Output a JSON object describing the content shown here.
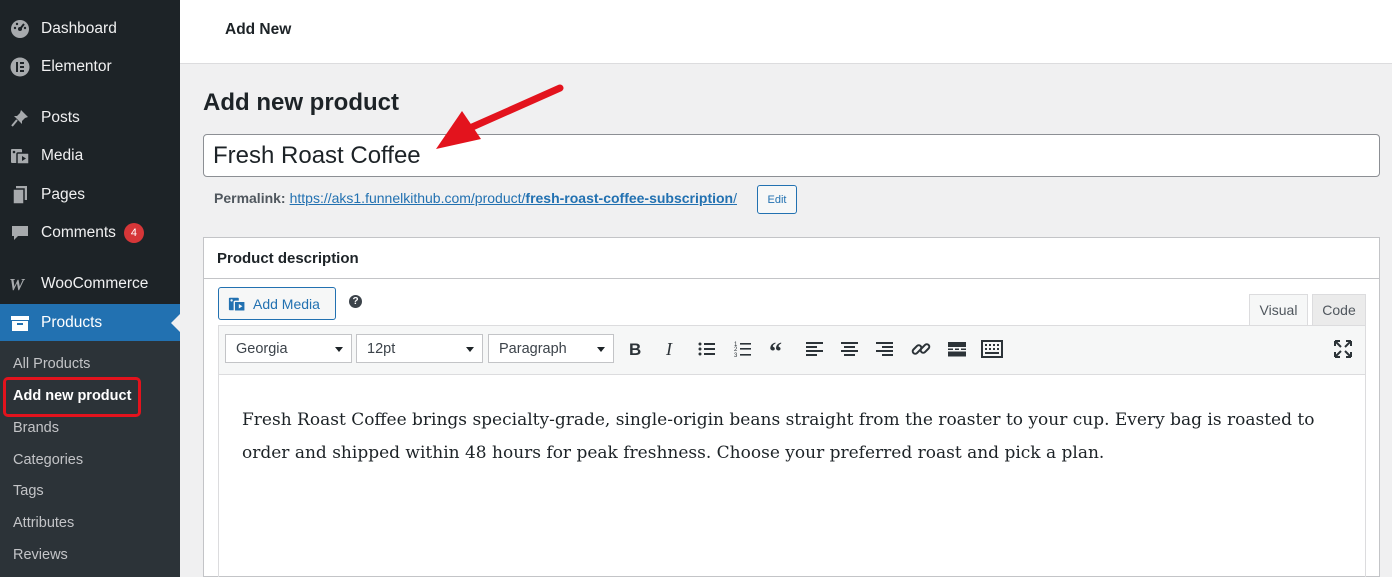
{
  "sidebar": {
    "items": [
      {
        "label": "Dashboard",
        "icon": "dashboard-icon"
      },
      {
        "label": "Elementor",
        "icon": "elementor-icon"
      },
      {
        "label": "Posts",
        "icon": "pin-icon"
      },
      {
        "label": "Media",
        "icon": "media-icon"
      },
      {
        "label": "Pages",
        "icon": "pages-icon"
      },
      {
        "label": "Comments",
        "icon": "comment-icon",
        "badge": "4"
      },
      {
        "label": "WooCommerce",
        "icon": "woocommerce-icon"
      },
      {
        "label": "Products",
        "icon": "archive-icon",
        "active": true
      }
    ],
    "submenu": [
      "All Products",
      "Add new product",
      "Brands",
      "Categories",
      "Tags",
      "Attributes",
      "Reviews"
    ]
  },
  "topbar": {
    "title": "Add New"
  },
  "main": {
    "heading": "Add new product",
    "title_value": "Fresh Roast Coffee",
    "permalink": {
      "label": "Permalink:",
      "url_base": "https://aks1.funnelkithub.com/product/",
      "slug": "fresh-roast-coffee-subscription",
      "trailing": "/",
      "edit_label": "Edit"
    },
    "description": {
      "header": "Product description",
      "add_media": "Add Media",
      "tabs": {
        "visual": "Visual",
        "code": "Code"
      },
      "font_family": "Georgia",
      "font_size": "12pt",
      "format": "Paragraph",
      "text": "Fresh Roast Coffee brings specialty-grade, single-origin beans straight from the roaster to your cup. Every bag is roasted to order and shipped within 48 hours for peak freshness. Choose your preferred roast and pick a plan."
    }
  },
  "colors": {
    "sidebar_bg": "#1d2327",
    "accent": "#2271b1",
    "highlight": "#e3131d",
    "badge": "#d63638"
  }
}
